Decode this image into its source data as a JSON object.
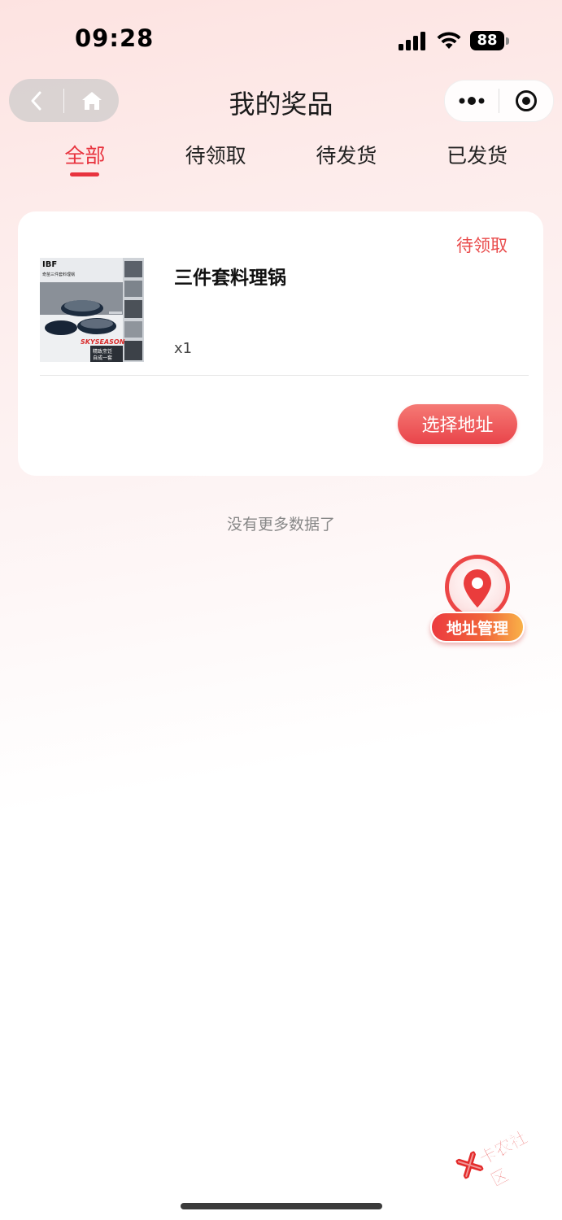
{
  "status_bar": {
    "time": "09:28",
    "battery": "88"
  },
  "nav": {
    "title": "我的奖品"
  },
  "tabs": [
    {
      "label": "全部",
      "active": true
    },
    {
      "label": "待领取",
      "active": false
    },
    {
      "label": "待发货",
      "active": false
    },
    {
      "label": "已发货",
      "active": false
    }
  ],
  "prize": {
    "status": "待领取",
    "name": "三件套料理锅",
    "quantity": "x1",
    "image_text": {
      "brand": "IBF",
      "subtitle": "奇苗三件套料理锅",
      "logo": "SKYSEASON",
      "caption_1": "精致烹饪",
      "caption_2": "自成一套"
    },
    "action_label": "选择地址"
  },
  "list_end_text": "没有更多数据了",
  "fab": {
    "label": "地址管理"
  },
  "watermark": {
    "text": "卡农社区"
  },
  "colors": {
    "accent": "#e8333e",
    "button_gradient_top": "#f57a75",
    "button_gradient_bottom": "#e9444a"
  }
}
